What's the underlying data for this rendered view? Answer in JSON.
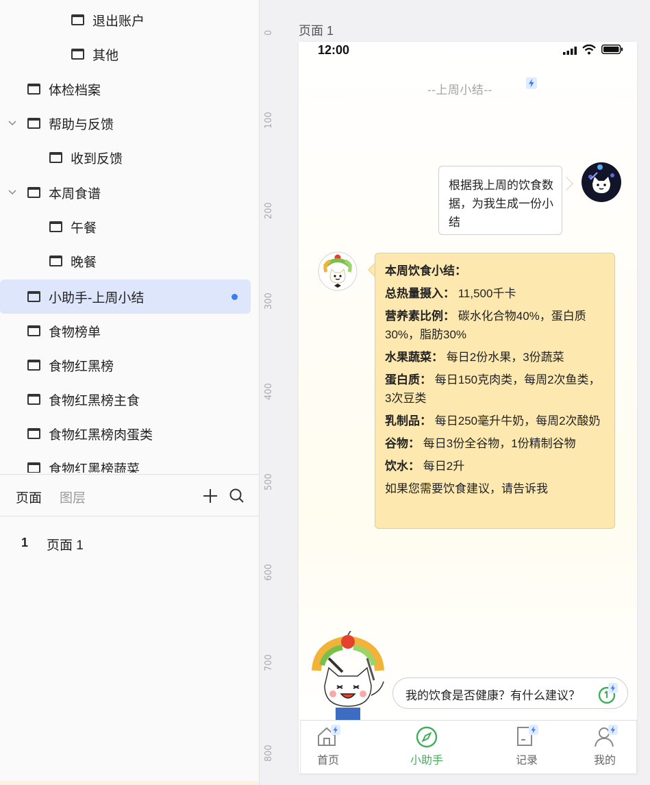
{
  "tree": {
    "items": [
      {
        "label": "退出账户",
        "expanded": null
      },
      {
        "label": "其他",
        "expanded": null
      },
      {
        "label": "体检档案",
        "expanded": null
      },
      {
        "label": "帮助与反馈",
        "expanded": true
      },
      {
        "label": "收到反馈",
        "expanded": null
      },
      {
        "label": "本周食谱",
        "expanded": true
      },
      {
        "label": "午餐",
        "expanded": null
      },
      {
        "label": "晚餐",
        "expanded": null
      },
      {
        "label": "小助手-上周小结",
        "expanded": null,
        "selected": true
      },
      {
        "label": "食物榜单",
        "expanded": null
      },
      {
        "label": "食物红黑榜",
        "expanded": null
      },
      {
        "label": "食物红黑榜主食",
        "expanded": null
      },
      {
        "label": "食物红黑榜肉蛋类",
        "expanded": null
      },
      {
        "label": "食物红黑榜蔬菜",
        "expanded": null
      }
    ]
  },
  "pages_panel": {
    "tab_pages": "页面",
    "tab_layers": "图层",
    "add_icon": "plus-icon",
    "search_icon": "search-icon",
    "list": [
      {
        "number": "1",
        "name": "页面 1"
      }
    ]
  },
  "ruler": {
    "ticks": [
      "0",
      "100",
      "200",
      "300",
      "400",
      "500",
      "600",
      "700",
      "800"
    ]
  },
  "canvas": {
    "page_label": "页面 1",
    "status": {
      "time": "12:00"
    },
    "chat": {
      "title": "--上周小结--",
      "user_message": "根据我上周的饮食数据，为我生成一份小结",
      "summary_heading": "本周饮食小结：",
      "summary": [
        {
          "key": "总热量摄入：",
          "value": "11,500千卡"
        },
        {
          "key": "营养素比例：",
          "value": "碳水化合物40%，蛋白质30%，脂肪30%"
        },
        {
          "key": "水果蔬菜：",
          "value": "每日2份水果，3份蔬菜"
        },
        {
          "key": "蛋白质：",
          "value": "每日150克肉类，每周2次鱼类，3次豆类"
        },
        {
          "key": "乳制品：",
          "value": "每日250毫升牛奶，每周2次酸奶"
        },
        {
          "key": "谷物：",
          "value": "每日3份全谷物，1份精制谷物"
        },
        {
          "key": "饮水：",
          "value": "每日2升"
        }
      ],
      "closing": "如果您需要饮食建议，请告诉我",
      "suggestion": "我的饮食是否健康？有什么建议？"
    },
    "tabs": [
      {
        "label": "首页",
        "icon": "home-icon",
        "active": false
      },
      {
        "label": "小助手",
        "icon": "compass-icon",
        "active": true
      },
      {
        "label": "记录",
        "icon": "document-icon",
        "active": false
      },
      {
        "label": "我的",
        "icon": "user-icon",
        "active": false
      }
    ],
    "colors": {
      "accent": "#3fae5a",
      "bubble": "#fde9b0",
      "selection": "#dde6fb",
      "dot": "#3b7cf4"
    }
  }
}
